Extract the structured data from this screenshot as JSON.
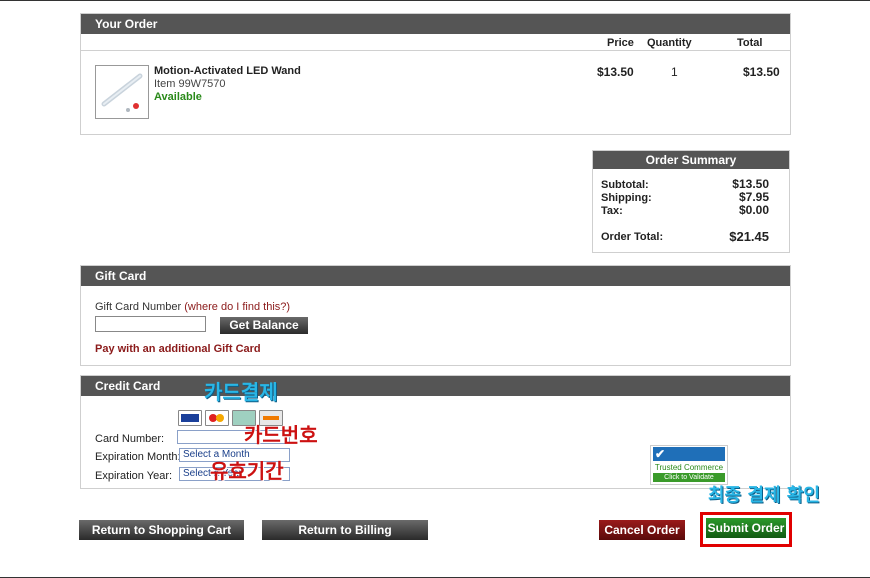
{
  "order": {
    "header": "Your Order",
    "col_price": "Price",
    "col_quantity": "Quantity",
    "col_total": "Total",
    "item": {
      "name": "Motion-Activated LED Wand",
      "sku": "Item 99W7570",
      "availability": "Available",
      "price": "$13.50",
      "quantity": "1",
      "total": "$13.50"
    }
  },
  "summary": {
    "header": "Order Summary",
    "subtotal_label": "Subtotal:",
    "subtotal_value": "$13.50",
    "shipping_label": "Shipping:",
    "shipping_value": "$7.95",
    "tax_label": "Tax:",
    "tax_value": "$0.00",
    "total_label": "Order Total:",
    "total_value": "$21.45"
  },
  "gift_card": {
    "header": "Gift Card",
    "number_label": "Gift Card Number",
    "help_link": "(where do I find this?)",
    "input_value": "",
    "balance_button": "Get Balance",
    "additional_link": "Pay with an additional Gift Card"
  },
  "credit_card": {
    "header": "Credit Card",
    "card_number_label": "Card Number:",
    "card_number_value": "",
    "exp_month_label": "Expiration Month:",
    "exp_month_value": "Select a Month",
    "exp_year_label": "Expiration Year:",
    "exp_year_value": "Select a Year",
    "accepted_cards": [
      "visa-icon",
      "mastercard-icon",
      "amex-icon",
      "discover-icon"
    ],
    "trust_badge": {
      "brand": "Trustwave",
      "line1": "Trusted Commerce",
      "line2": "Click to Validate"
    }
  },
  "annotations": {
    "payment": "카드결제",
    "card_number": "카드번호",
    "expiry": "유효기간",
    "final_confirm": "최종 결제 확인"
  },
  "actions": {
    "return_cart": "Return to Shopping Cart",
    "return_billing": "Return to Billing",
    "cancel": "Cancel Order",
    "submit": "Submit Order"
  },
  "colors": {
    "header_bg": "#555555",
    "available_green": "#2a8a1a",
    "cancel_bg": "#7a1010",
    "submit_bg": "#1e7d1e",
    "highlight_red": "#e00000",
    "annotation_cyan": "#29b6e6",
    "annotation_red": "#cc1111"
  }
}
